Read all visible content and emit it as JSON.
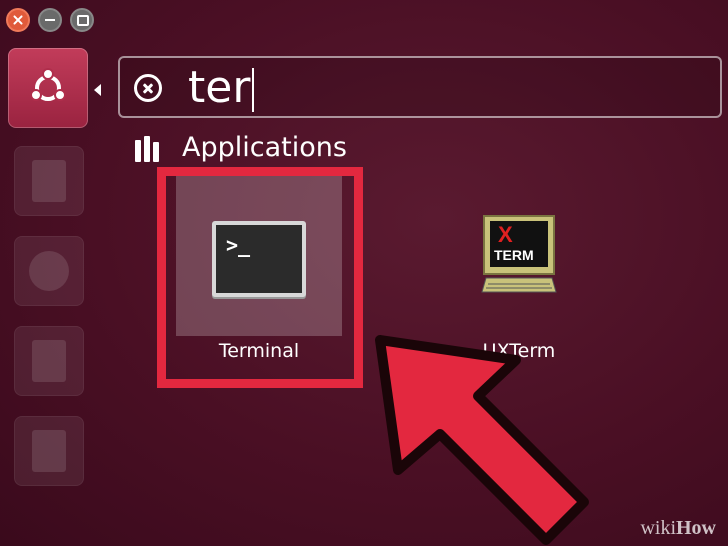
{
  "window": {
    "controls": [
      "close",
      "minimize",
      "maximize"
    ]
  },
  "launcher": {
    "items": [
      "dash-home",
      "files",
      "firefox",
      "libreoffice-writer",
      "libreoffice-calc"
    ]
  },
  "search": {
    "value": "ter"
  },
  "category": {
    "title": "Applications"
  },
  "results": [
    {
      "label": "Terminal",
      "icon_text": ">_",
      "highlighted": true
    },
    {
      "label": "UXTerm",
      "icon_text_top": "X",
      "icon_text_bottom": "TERM"
    }
  ],
  "watermark": {
    "prefix": "wiki",
    "suffix": "How"
  },
  "colors": {
    "annotation_red": "#e3283f",
    "background": "#4a0f24",
    "dash_accent": "#c23c5a"
  }
}
